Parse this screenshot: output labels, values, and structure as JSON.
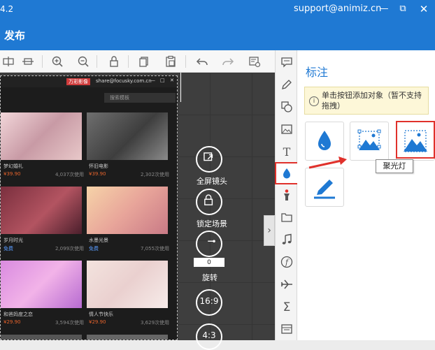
{
  "app": {
    "version": "4.2",
    "support_email": "support@animiz.cn",
    "publish_label": "发布"
  },
  "slide": {
    "brand_tag": "万彩影像",
    "email": "share@focusky.com.cn",
    "search_placeholder": "搜索模板",
    "templates": [
      {
        "name": "梦幻婚礼",
        "price": "¥39.90",
        "count": "4,037次使用"
      },
      {
        "name": "怀旧电影",
        "price": "¥39.90",
        "count": "2,302次使用"
      },
      {
        "name": "岁月时光",
        "price": "免费",
        "count": "2,099次使用"
      },
      {
        "name": "水墨光景",
        "price": "免费",
        "count": "7,055次使用"
      },
      {
        "name": "和爸妈度之恋",
        "price": "¥29.90",
        "count": "3,594次使用"
      },
      {
        "name": "情人节快乐",
        "price": "¥29.90",
        "count": "3,629次使用"
      }
    ]
  },
  "camera_controls": {
    "fullscreen_label": "全屏镜头",
    "lock_label": "锁定场景",
    "rotate_value": "0",
    "rotate_label": "旋转",
    "ratio_16_9": "16:9",
    "ratio_4_3": "4:3"
  },
  "panel": {
    "title": "标注",
    "hint": "单击按钮添加对象（暂不支持拖拽）",
    "tooltip": "聚光灯"
  },
  "colors": {
    "brand_blue": "#1f79d3",
    "highlight_red": "#e0312b"
  }
}
